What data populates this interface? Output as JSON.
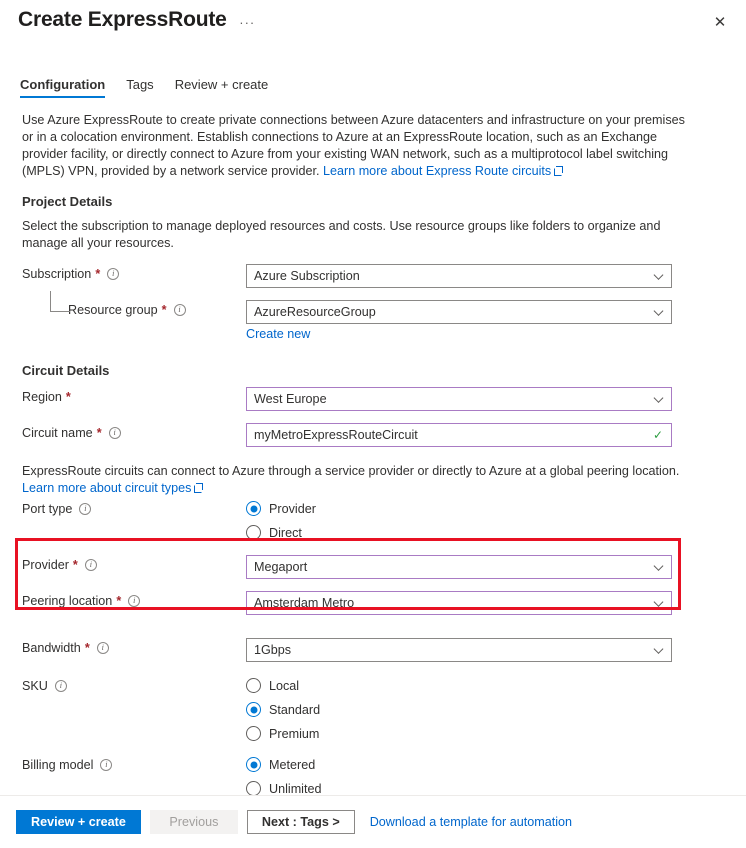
{
  "window": {
    "title": "Create ExpressRoute",
    "ellipsis": "···",
    "close_icon": "✕"
  },
  "tabs": [
    {
      "label": "Configuration",
      "active": true
    },
    {
      "label": "Tags",
      "active": false
    },
    {
      "label": "Review + create",
      "active": false
    }
  ],
  "description": {
    "text": "Use Azure ExpressRoute to create private connections between Azure datacenters and infrastructure on your premises or in a colocation environment. Establish connections to Azure at an ExpressRoute location, such as an Exchange provider facility, or directly connect to Azure from your existing WAN network, such as a multiprotocol label switching (MPLS) VPN, provided by a network service provider. ",
    "link": "Learn more about Express Route circuits"
  },
  "project_details": {
    "heading": "Project Details",
    "subtext": "Select the subscription to manage deployed resources and costs. Use resource groups like folders to organize and manage all your resources.",
    "subscription": {
      "label": "Subscription",
      "required": "*",
      "value": "Azure Subscription"
    },
    "resource_group": {
      "label": "Resource group",
      "required": "*",
      "value": "AzureResourceGroup",
      "create_new": "Create new"
    }
  },
  "circuit_details": {
    "heading": "Circuit Details",
    "region": {
      "label": "Region",
      "required": "*",
      "value": "West Europe"
    },
    "circuit_name": {
      "label": "Circuit name",
      "required": "*",
      "value": "myMetroExpressRouteCircuit",
      "valid_icon": "✓"
    },
    "circuit_types_text": "ExpressRoute circuits can connect to Azure through a service provider or directly to Azure at a global peering location.",
    "circuit_types_link": "Learn more about circuit types",
    "port_type": {
      "label": "Port type",
      "options": [
        {
          "label": "Provider",
          "selected": true
        },
        {
          "label": "Direct",
          "selected": false
        }
      ]
    },
    "provider": {
      "label": "Provider",
      "required": "*",
      "value": "Megaport"
    },
    "peering_location": {
      "label": "Peering location",
      "required": "*",
      "value": "Amsterdam Metro"
    },
    "bandwidth": {
      "label": "Bandwidth",
      "required": "*",
      "value": "1Gbps"
    },
    "sku": {
      "label": "SKU",
      "options": [
        {
          "label": "Local",
          "selected": false
        },
        {
          "label": "Standard",
          "selected": true
        },
        {
          "label": "Premium",
          "selected": false
        }
      ]
    },
    "billing_model": {
      "label": "Billing model",
      "options": [
        {
          "label": "Metered",
          "selected": true
        },
        {
          "label": "Unlimited",
          "selected": false
        }
      ]
    }
  },
  "footer": {
    "review_create": "Review + create",
    "previous": "Previous",
    "next": "Next : Tags >",
    "download_template": "Download a template for automation"
  },
  "colors": {
    "accent": "#0078d4",
    "link": "#0066cc",
    "required": "#a4262c",
    "validated_border": "#a97bc4",
    "valid_check": "#2e9e42",
    "annotation": "#e81123"
  }
}
